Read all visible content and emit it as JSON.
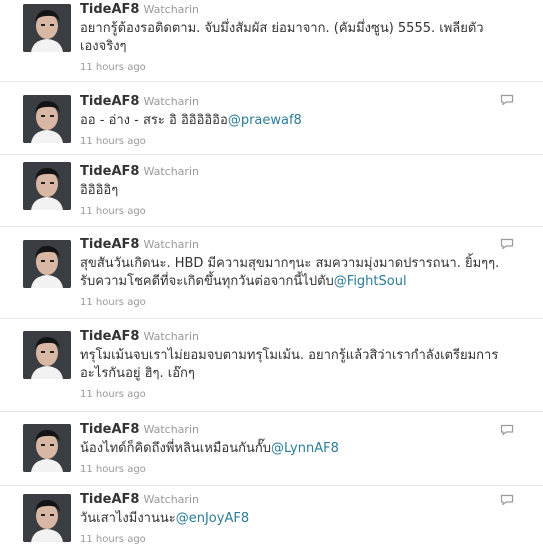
{
  "colors": {
    "screen_name": "#333333",
    "full_name": "#999999",
    "mention_link": "#2a7d9a",
    "timestamp": "#999999",
    "divider": "#e6e6e6"
  },
  "tweets": [
    {
      "screen_name": "TideAF8",
      "full_name": "Watcharin",
      "text_lines": [
        "อยากรู้ต้องรอติดตาม. จับมึ่งสัมผัส ย่อมาจาก. (คัมมึ่งซูน) 5555. เพลียตัว",
        "เองจริงๆ"
      ],
      "mention": "",
      "time": "11 hours ago",
      "reply_icon": ""
    },
    {
      "screen_name": "TideAF8",
      "full_name": "Watcharin",
      "text_lines": [
        "ออ - อ่าง - สระ อิ อิอิอิอิอิอ"
      ],
      "mention": "@praewaf8",
      "time": "11 hours ago",
      "reply_icon": "reply-speech-bubble-icon"
    },
    {
      "screen_name": "TideAF8",
      "full_name": "Watcharin",
      "text_lines": [
        "อิอิอิอิๆ"
      ],
      "mention": "",
      "time": "11 hours ago",
      "reply_icon": ""
    },
    {
      "screen_name": "TideAF8",
      "full_name": "Watcharin",
      "text_lines": [
        "สุขสันวันเกิดนะ. HBD มีความสุขมากๆนะ สมความมุ่งมาดปรารถนา. ยิ้มๆๆ.",
        "รับความโชคดีที่จะเกิดขึ้นทุกวันต่อจากนี้ไปตับ"
      ],
      "mention": "@FightSoul",
      "time": "11 hours ago",
      "reply_icon": "reply-speech-bubble-icon"
    },
    {
      "screen_name": "TideAF8",
      "full_name": "Watcharin",
      "text_lines": [
        "ทรุโมเม้นจบเราไม่ยอมจบตามทรุโมเม้น. อยากรู้แล้วสิว่าเรากำลังเตรียมการ",
        "อะไรกันอยู่ ฮิๆ. เอ๊กๆ"
      ],
      "mention": "",
      "time": "11 hours ago",
      "reply_icon": ""
    },
    {
      "screen_name": "TideAF8",
      "full_name": "Watcharin",
      "text_lines": [
        "น้องไทด์ก็คิดถึงพี่หลินเหมือนกันกั๊บ"
      ],
      "mention": "@LynnAF8",
      "time": "11 hours ago",
      "reply_icon": "reply-speech-bubble-icon"
    },
    {
      "screen_name": "TideAF8",
      "full_name": "Watcharin",
      "text_lines": [
        "วันเสาไงมีงานนะ"
      ],
      "mention": "@enJoyAF8",
      "time": "11 hours ago",
      "reply_icon": "reply-speech-bubble-icon"
    }
  ]
}
